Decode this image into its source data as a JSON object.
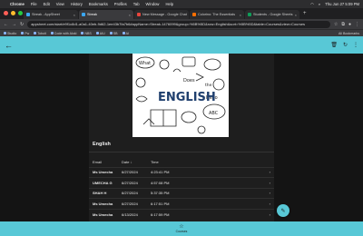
{
  "menubar": {
    "apple": "",
    "app": "Chrome",
    "items": [
      "File",
      "Edit",
      "View",
      "History",
      "Bookmarks",
      "Profiles",
      "Tab",
      "Window",
      "Help"
    ],
    "datetime": "Thu Jun 27 5:09 PM"
  },
  "tabs": [
    {
      "label": "Streak - AppSheet",
      "color": "#3ba7f2",
      "active": false
    },
    {
      "label": "Streak",
      "color": "#3ba7f2",
      "active": true
    },
    {
      "label": "New Message - Google Chat",
      "color": "#e8453c",
      "active": false
    },
    {
      "label": "Colorino: The Essentials",
      "color": "#ff6f00",
      "active": false
    },
    {
      "label": "Students - Google Sheets",
      "color": "#0f9d58",
      "active": false
    }
  ],
  "address": {
    "url": "appsheet.com/start/e9f1c8d1-a0a1-40eb-9d62-1ee43b7fa7b6#appName=Streak-1476099&group=%5B%5D&row=English&sort=%5B%5D&table=Courses&view=Courses"
  },
  "bookmarks": [
    "Studio",
    "Pw",
    "Toboit",
    "Code with Aloki",
    "NBS",
    "AIU",
    "SB",
    "AI"
  ],
  "bookmarks_all": "All Bookmarks",
  "image": {
    "words": [
      "What",
      "ENGLISH",
      "ABC",
      "Does",
      "Hello",
      "the"
    ]
  },
  "section_title": "English",
  "table": {
    "headers": [
      "Email",
      "Date",
      "Time"
    ],
    "sort_indicator": "↓",
    "rows": [
      {
        "email": "Ms Umecha",
        "date": "6/27/2024",
        "time": "4:23:41 PM"
      },
      {
        "email": "UMECHA G",
        "date": "6/27/2024",
        "time": "4:57:08 PM"
      },
      {
        "email": "SHAH H",
        "date": "6/27/2024",
        "time": "5:37:35 PM"
      },
      {
        "email": "Ms Umecha",
        "date": "6/27/2024",
        "time": "6:17:51 PM"
      },
      {
        "email": "Ms Umecha",
        "date": "6/13/2024",
        "time": "6:17:59 PM"
      }
    ]
  },
  "bottom_nav": {
    "label": "Courses"
  },
  "colors": {
    "accent": "#58c8d6",
    "background": "#141414",
    "panel": "#1e1e1e"
  }
}
